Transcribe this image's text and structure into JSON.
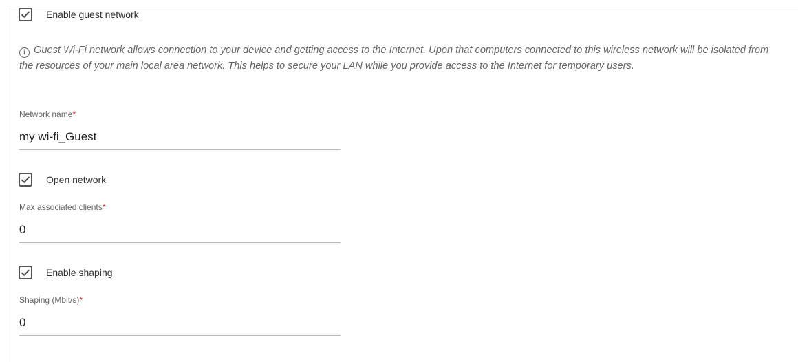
{
  "guest": {
    "enable_label": "Enable guest network",
    "enable_checked": true,
    "info_text": "Guest Wi-Fi network allows connection to your device and getting access to the Internet. Upon that computers connected to this wireless network will be isolated from the resources of your main local area network. This helps to secure your LAN while you provide access to the Internet for temporary users.",
    "info_icon": "info-circle-icon"
  },
  "network_name": {
    "label": "Network name",
    "required_mark": "*",
    "value": "my wi-fi_Guest"
  },
  "open_network": {
    "label": "Open network",
    "checked": true
  },
  "max_clients": {
    "label": "Max associated clients",
    "required_mark": "*",
    "value": "0"
  },
  "shaping": {
    "enable_label": "Enable shaping",
    "checked": true,
    "label": "Shaping (Mbit/s)",
    "required_mark": "*",
    "value": "0"
  },
  "colors": {
    "checkbox_border": "#555555",
    "required": "#c62828",
    "underline": "#b8b8b8"
  }
}
